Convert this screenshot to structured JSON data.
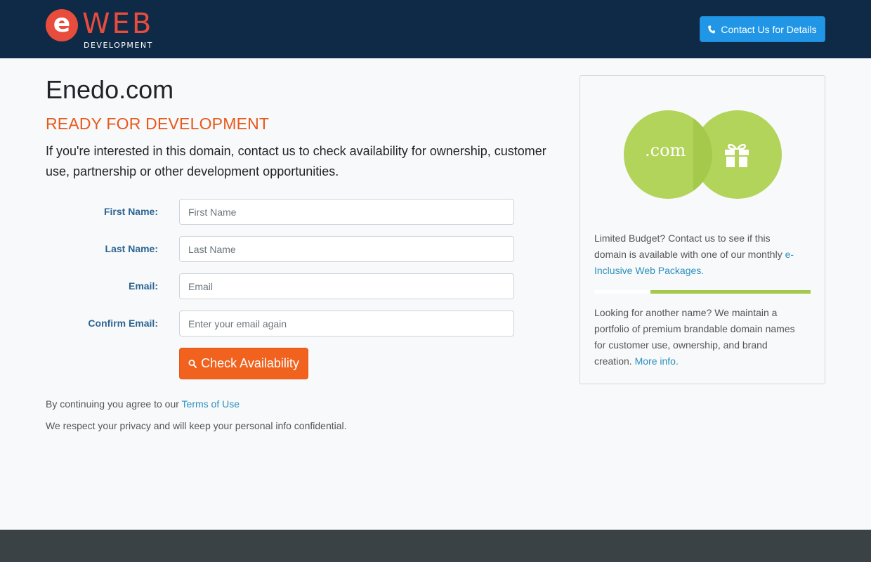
{
  "header": {
    "logo": {
      "letter": "e",
      "brand": "WEB",
      "tagline": "DEVELOPMENT"
    },
    "contact_button": "Contact Us for Details"
  },
  "main": {
    "title": "Enedo.com",
    "subtitle": "READY FOR DEVELOPMENT",
    "lead": "If you're interested in this domain, contact us to check availability for ownership, customer use, partnership or other development opportunities.",
    "form": {
      "fields": [
        {
          "label": "First Name:",
          "placeholder": "First Name"
        },
        {
          "label": "Last Name:",
          "placeholder": "Last Name"
        },
        {
          "label": "Email:",
          "placeholder": "Email"
        },
        {
          "label": "Confirm Email:",
          "placeholder": "Enter your email again"
        }
      ],
      "submit": "Check Availability"
    },
    "terms_prefix": "By continuing you agree to our ",
    "terms_link": "Terms of Use",
    "privacy": "We respect your privacy and will keep your personal info confidential."
  },
  "sidebar": {
    "venn_text": ".com",
    "budget_text": "Limited Budget? Contact us to see if this domain is available with one of our monthly ",
    "budget_link": "e-Inclusive Web Packages.",
    "portfolio_text": "Looking for another name? We maintain a portfolio of premium brandable domain names for customer use, ownership, and brand creation. ",
    "portfolio_link": "More info."
  },
  "icons": {
    "contact": "phone-icon",
    "submit": "search-icon",
    "venn": "gift-icon"
  },
  "colors": {
    "header_bg": "#0e2a47",
    "brand_red": "#e74c3c",
    "accent_blue": "#2196e6",
    "accent_orange": "#f0621e",
    "accent_green": "#a4c94b",
    "footer_bg": "#3a4246"
  }
}
